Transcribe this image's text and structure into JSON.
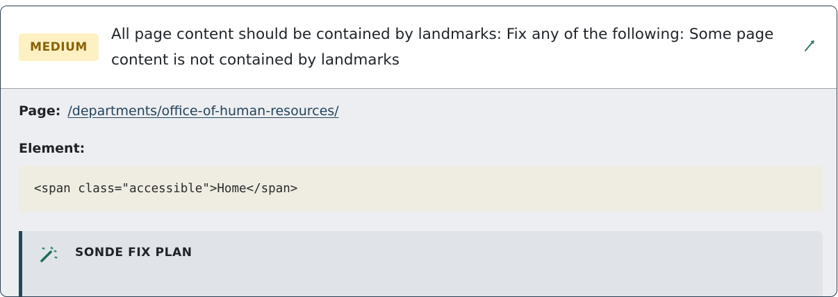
{
  "issue": {
    "severity": "MEDIUM",
    "title": "All page content should be contained by landmarks: Fix any of the following: Some page content is not contained by landmarks",
    "edit_icon": "pencil-icon"
  },
  "details": {
    "page_label": "Page:",
    "page_link": "/departments/office-of-human-resources/",
    "element_label": "Element:",
    "element_code": "<span class=\"accessible\">Home</span>"
  },
  "fix_plan": {
    "icon": "magic-wand-icon",
    "title": "SONDE FIX PLAN"
  },
  "colors": {
    "badge_bg": "#fdf0c2",
    "badge_text": "#8a6207",
    "accent": "#1e4a56",
    "link": "#23435c"
  }
}
